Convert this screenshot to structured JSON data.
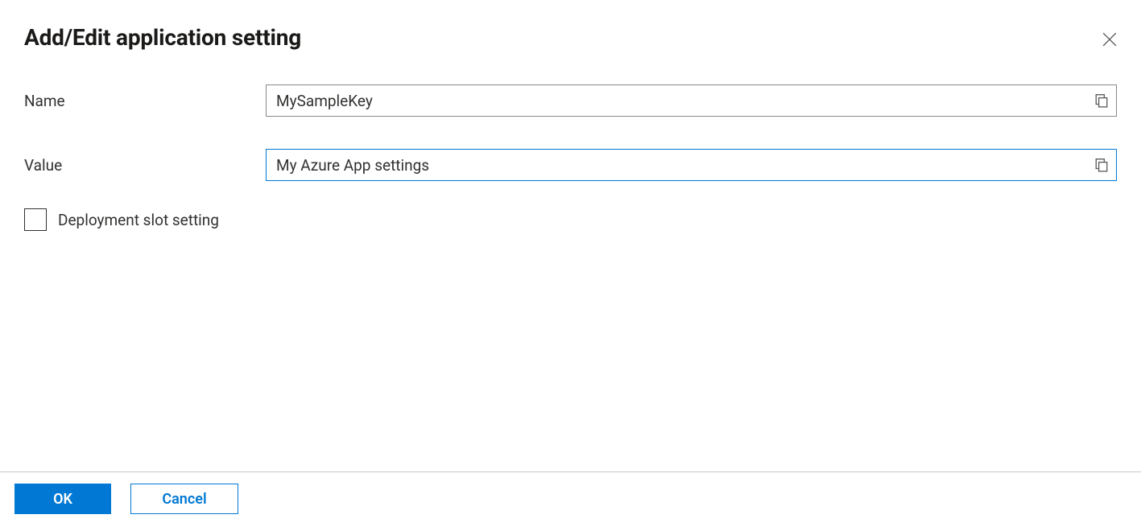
{
  "header": {
    "title": "Add/Edit application setting"
  },
  "form": {
    "name_label": "Name",
    "name_value": "MySampleKey",
    "value_label": "Value",
    "value_value": "My Azure App settings",
    "deployment_slot_label": "Deployment slot setting",
    "deployment_slot_checked": false
  },
  "footer": {
    "ok_label": "OK",
    "cancel_label": "Cancel"
  }
}
